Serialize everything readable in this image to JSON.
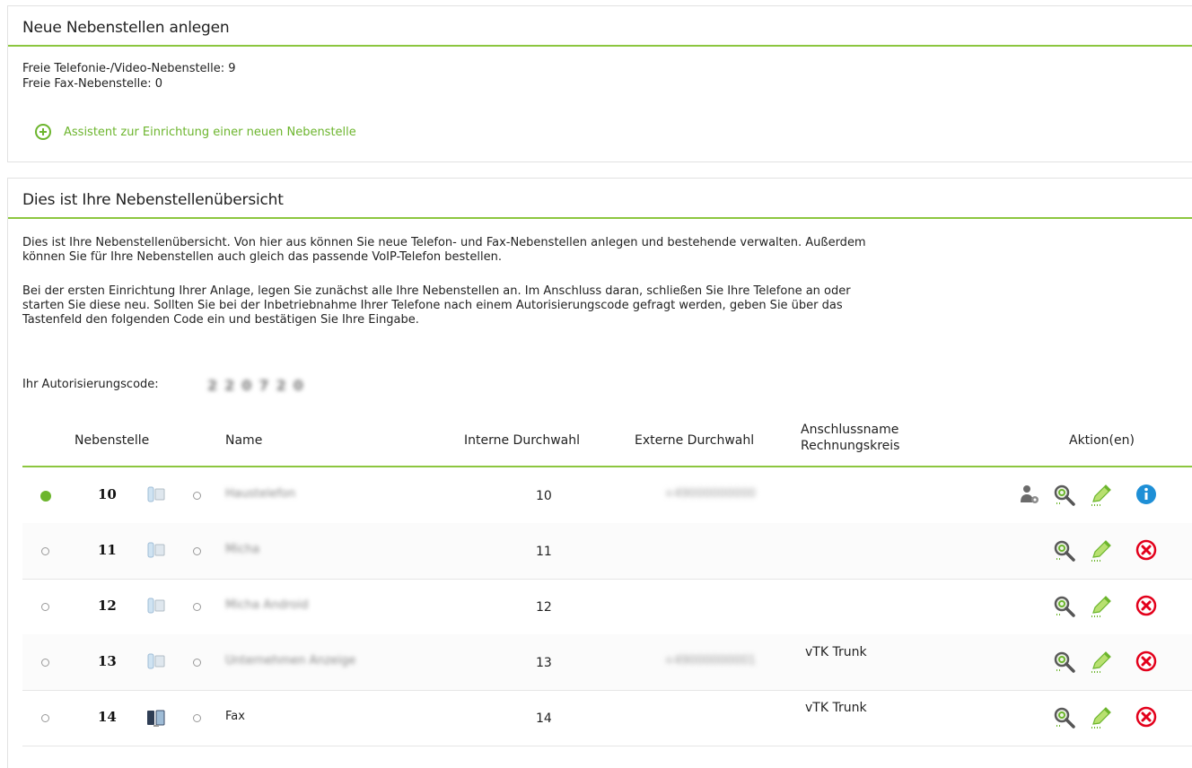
{
  "panel1": {
    "title": "Neue Nebenstellen anlegen",
    "free_phone_label": "Freie Telefonie-/Video-Nebenstelle: 9",
    "free_fax_label": "Freie Fax-Nebenstelle: 0",
    "assistant_label": "Assistent zur Einrichtung einer neuen Nebenstelle"
  },
  "panel2": {
    "title": "Dies ist Ihre Nebenstellenübersicht",
    "para1_line1": "Dies ist Ihre Nebenstellenübersicht. Von hier aus können Sie neue Telefon- und Fax-Nebenstellen anlegen und bestehende verwalten. Außerdem",
    "para1_line2": "können Sie für Ihre Nebenstellen auch gleich das passende VoIP-Telefon bestellen.",
    "para2_line1": "Bei der ersten Einrichtung Ihrer Anlage, legen Sie zunächst alle Ihre Nebenstellen an. Im Anschluss daran, schließen Sie Ihre Telefone an oder",
    "para2_line2": "starten Sie diese neu. Sollten Sie bei der Inbetriebnahme Ihrer Telefone nach einem Autorisierungscode gefragt werden, geben Sie über das",
    "para2_line3": "Tastenfeld den folgenden Code ein und bestätigen Sie Ihre Eingabe.",
    "auth_label": "Ihr Autorisierungscode:",
    "auth_code_digits": [
      "2",
      "2",
      "0",
      "7",
      "2",
      "0"
    ]
  },
  "table": {
    "headers": {
      "nebenstelle": "Nebenstelle",
      "name": "Name",
      "interne": "Interne Durchwahl",
      "externe": "Externe Durchwahl",
      "anschluss_line1": "Anschlussname",
      "anschluss_line2": "Rechnungskreis",
      "aktion": "Aktion(en)"
    },
    "rows": [
      {
        "ext": "10",
        "name": "Haustelefon",
        "intern": "10",
        "extern": "+49000000000",
        "anschluss": ""
      },
      {
        "ext": "11",
        "name": "Micha",
        "intern": "11",
        "extern": "",
        "anschluss": ""
      },
      {
        "ext": "12",
        "name": "Micha Android",
        "intern": "12",
        "extern": "",
        "anschluss": ""
      },
      {
        "ext": "13",
        "name": "Unternehmen Anzeige",
        "intern": "13",
        "extern": "+49000000001",
        "anschluss": "vTK Trunk"
      },
      {
        "ext": "14",
        "name": "Fax",
        "intern": "14",
        "extern": "",
        "anschluss": "vTK Trunk"
      }
    ]
  },
  "colors": {
    "accent_green": "#8cc63f",
    "link_green": "#6cb52d",
    "delete_red": "#e3001b",
    "info_blue": "#1e8fd6"
  },
  "icons": {
    "add": "plus-circle-icon",
    "phone": "phone-icon",
    "fax": "fax-icon",
    "user_settings": "user-settings-icon",
    "search": "magnifier-icon",
    "edit": "pencil-icon",
    "info": "info-icon",
    "delete": "delete-circle-icon"
  }
}
